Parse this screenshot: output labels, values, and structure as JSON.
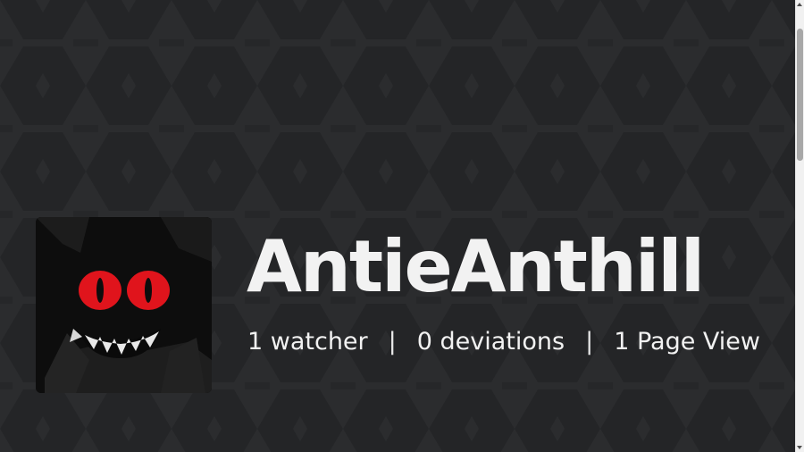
{
  "profile": {
    "username": "AntieAnthill",
    "avatar_icon": "red-eyed-creature-avatar",
    "stats": {
      "watchers": "1 watcher",
      "deviations": "0 deviations",
      "page_views": "1 Page View",
      "separator": "|"
    }
  },
  "colors": {
    "background": "#2b2c2e",
    "pattern": "#232426",
    "text": "#f2f2f2",
    "avatar_eye": "#e0141c"
  }
}
